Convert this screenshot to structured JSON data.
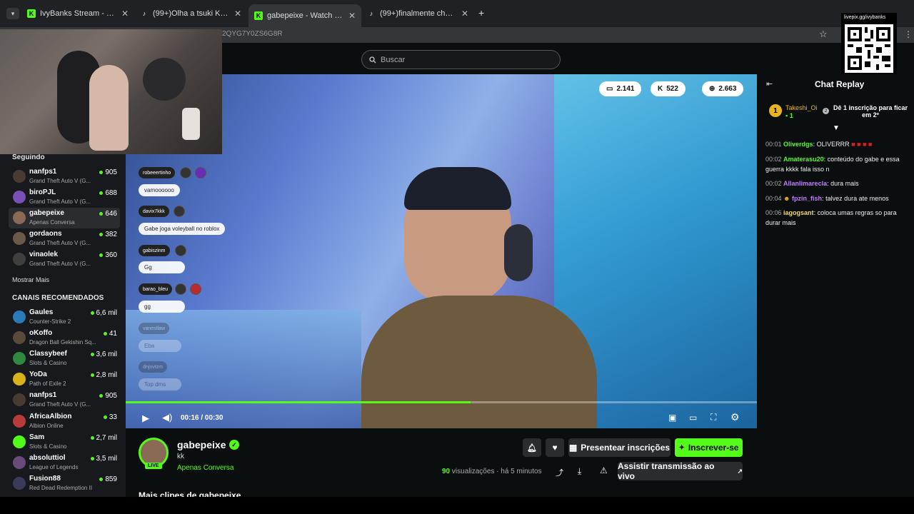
{
  "tabs": [
    {
      "label": "IvyBanks Stream - Watch Live o",
      "icon": "kick-icon"
    },
    {
      "label": "(99+)Olha a tsuki KKKKKKKKKK",
      "icon": "tiktok-icon"
    },
    {
      "label": "gabepeixe - Watch clips on Kick",
      "icon": "kick-icon"
    },
    {
      "label": "(99+)finalmente chegou o cach",
      "icon": "tiktok-icon"
    }
  ],
  "url_fragment": "2QYG7Y0ZS6G8R",
  "qr_label": "livepix.gg/ivybanks",
  "search_placeholder": "Buscar",
  "sidebar": {
    "following_title": "Seguindo",
    "following": [
      {
        "name": "nanfps1",
        "game": "Grand Theft Auto V (G...",
        "viewers": "905"
      },
      {
        "name": "biroPJL",
        "game": "Grand Theft Auto V (G...",
        "viewers": "688"
      },
      {
        "name": "gabepeixe",
        "game": "Apenas Conversa",
        "viewers": "646"
      },
      {
        "name": "gordaons",
        "game": "Grand Theft Auto V (G...",
        "viewers": "382"
      },
      {
        "name": "vinaolek",
        "game": "Grand Theft Auto V (G...",
        "viewers": "360"
      }
    ],
    "show_more": "Mostrar Mais",
    "recommended_title": "CANAIS RECOMENDADOS",
    "recommended": [
      {
        "name": "Gaules",
        "game": "Counter-Strike 2",
        "viewers": "6,6 mil"
      },
      {
        "name": "oKoffo",
        "game": "Dragon Ball Gekishin Sq...",
        "viewers": "41"
      },
      {
        "name": "Classybeef",
        "game": "Slots & Casino",
        "viewers": "3,6 mil"
      },
      {
        "name": "YoDa",
        "game": "Path of Exile 2",
        "viewers": "2,8 mil"
      },
      {
        "name": "nanfps1",
        "game": "Grand Theft Auto V (G...",
        "viewers": "905"
      },
      {
        "name": "AfricaAlbion",
        "game": "Albion Online",
        "viewers": "33"
      },
      {
        "name": "Sam",
        "game": "Slots & Casino",
        "viewers": "2,7 mil"
      },
      {
        "name": "absoluttiol",
        "game": "League of Legends",
        "viewers": "3,5 mil"
      },
      {
        "name": "Fusion88",
        "game": "Red Dead Redemption II",
        "viewers": "859"
      }
    ]
  },
  "video": {
    "stats": [
      {
        "icon": "chat-icon",
        "value": "2.141"
      },
      {
        "icon": "kick-icon",
        "value": "522"
      },
      {
        "icon": "globe-icon",
        "value": "2.663"
      }
    ],
    "overlay_chat": [
      {
        "nick": "robeeertinho",
        "msg": "vamoooooo"
      },
      {
        "nick": "davix7kkk",
        "msg": "Gabe joga voleyball no roblox"
      },
      {
        "nick": "gabiszinm",
        "msg": "Gg"
      },
      {
        "nick": "barao_bleu",
        "msg": "gg"
      },
      {
        "nick": "vanestlaw",
        "msg": "Eba"
      },
      {
        "nick": "dnjnvtzm",
        "msg": "Top dms"
      }
    ],
    "time_current": "00:16",
    "time_total": "00:30",
    "progress": 0.546
  },
  "clip": {
    "channel": "gabepeixe",
    "title": "kk",
    "category": "Apenas Conversa",
    "live_badge": "LIVE",
    "views": "90",
    "views_label": "visualizações",
    "age": "há 5 minutos",
    "gift_label": "Presentear inscrições",
    "subscribe_label": "Inscrever-se",
    "watch_live_label": "Assistir transmissão ao vivo",
    "more_clips": "Mais clipes de gabepeixe"
  },
  "chat": {
    "title": "Chat Replay",
    "leader": {
      "name": "Takeshi_Oi",
      "count": "1",
      "rank": "1"
    },
    "sub_prompt": "Dê 1 inscrição para ficar em 2º",
    "messages": [
      {
        "ts": "00:01",
        "user": "Oliverdgs",
        "color": "#53fc18",
        "text": "OLIVERRR"
      },
      {
        "ts": "00:02",
        "user": "Amaterasu20",
        "color": "#53fc18",
        "text": "conteúdo do gabe e essa guerra kkkk fala isso n"
      },
      {
        "ts": "00:02",
        "user": "Allanlimarecla",
        "color": "#c47cff",
        "text": "dura mais"
      },
      {
        "ts": "00:04",
        "user": "fpzin_fish",
        "color": "#c47cff",
        "text": "talvez dura ate menos"
      },
      {
        "ts": "00:06",
        "user": "iagogsant",
        "color": "#f2d57a",
        "text": "coloca umas regras so para durar mais"
      }
    ]
  },
  "colors": {
    "accent": "#53fc18",
    "bg": "#0b0e0f"
  }
}
